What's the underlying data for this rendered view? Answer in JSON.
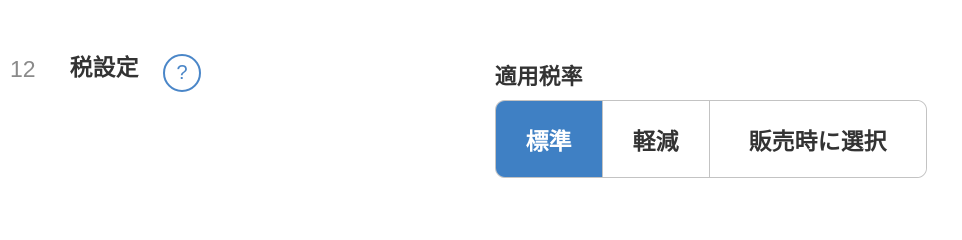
{
  "setting": {
    "number": "12",
    "title": "税設定",
    "help_icon": "question-mark-icon",
    "help_glyph": "?"
  },
  "tax_rate": {
    "label": "適用税率",
    "options": [
      {
        "label": "標準",
        "selected": true
      },
      {
        "label": "軽減",
        "selected": false
      },
      {
        "label": "販売時に選択",
        "selected": false
      }
    ],
    "accent_color": "#3f80c4"
  }
}
